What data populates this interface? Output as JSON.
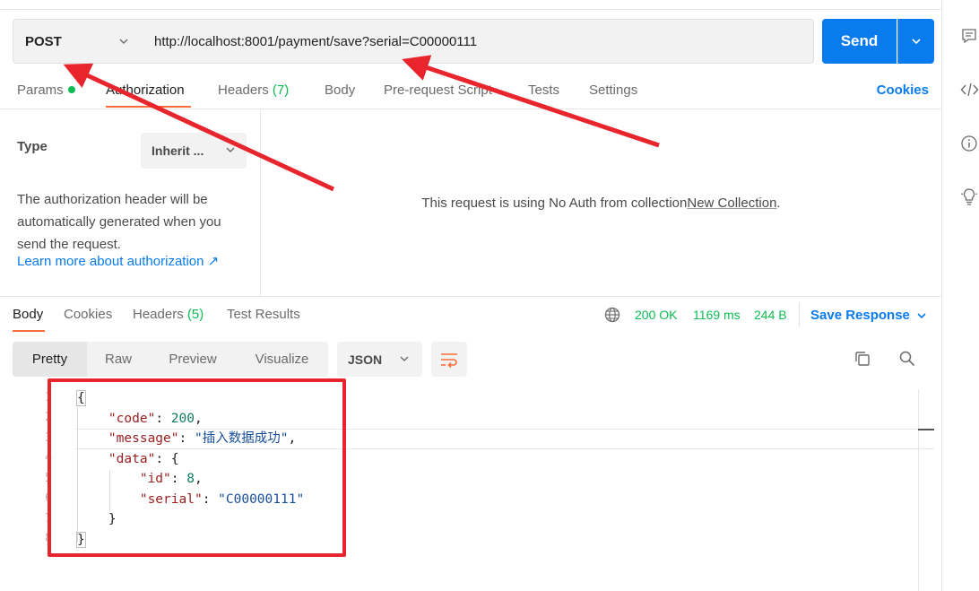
{
  "request": {
    "method": "POST",
    "url": "http://localhost:8001/payment/save?serial=C00000111",
    "send_label": "Send"
  },
  "req_tabs": {
    "params": "Params",
    "authorization": "Authorization",
    "headers": "Headers",
    "headers_count": "(7)",
    "body": "Body",
    "prerequest": "Pre-request Script",
    "tests": "Tests",
    "settings": "Settings",
    "cookies": "Cookies"
  },
  "auth": {
    "type_label": "Type",
    "type_value": "Inherit ...",
    "description": "The authorization header will be automatically generated when you send the request.",
    "learn_more": "Learn more about authorization ↗",
    "message_prefix": "This request is using No Auth from collection ",
    "collection_name": "New Collection",
    "message_suffix": "."
  },
  "resp_tabs": {
    "body": "Body",
    "cookies": "Cookies",
    "headers": "Headers",
    "headers_count": "(5)",
    "test_results": "Test Results"
  },
  "response_meta": {
    "status": "200 OK",
    "time": "1169 ms",
    "size": "244 B",
    "save_response": "Save Response"
  },
  "view": {
    "pretty": "Pretty",
    "raw": "Raw",
    "preview": "Preview",
    "visualize": "Visualize",
    "format": "JSON"
  },
  "code": {
    "line_numbers": [
      "1",
      "2",
      "3",
      "4",
      "5",
      "6",
      "7",
      "8"
    ],
    "open_brace": "{",
    "close_brace": "}",
    "code_key": "\"code\"",
    "code_val": "200",
    "message_key": "\"message\"",
    "message_val": "\"插入数据成功\"",
    "data_key": "\"data\"",
    "id_key": "\"id\"",
    "id_val": "8",
    "serial_key": "\"serial\"",
    "serial_val": "\"C00000111\""
  },
  "colors": {
    "accent": "#097bed",
    "tab_underline": "#ff6c37",
    "status_green": "#0cbb52",
    "annotation_red": "#e8242c"
  },
  "icons": {
    "rail": [
      "comment-icon",
      "code-icon",
      "info-icon",
      "lightbulb-icon"
    ]
  }
}
